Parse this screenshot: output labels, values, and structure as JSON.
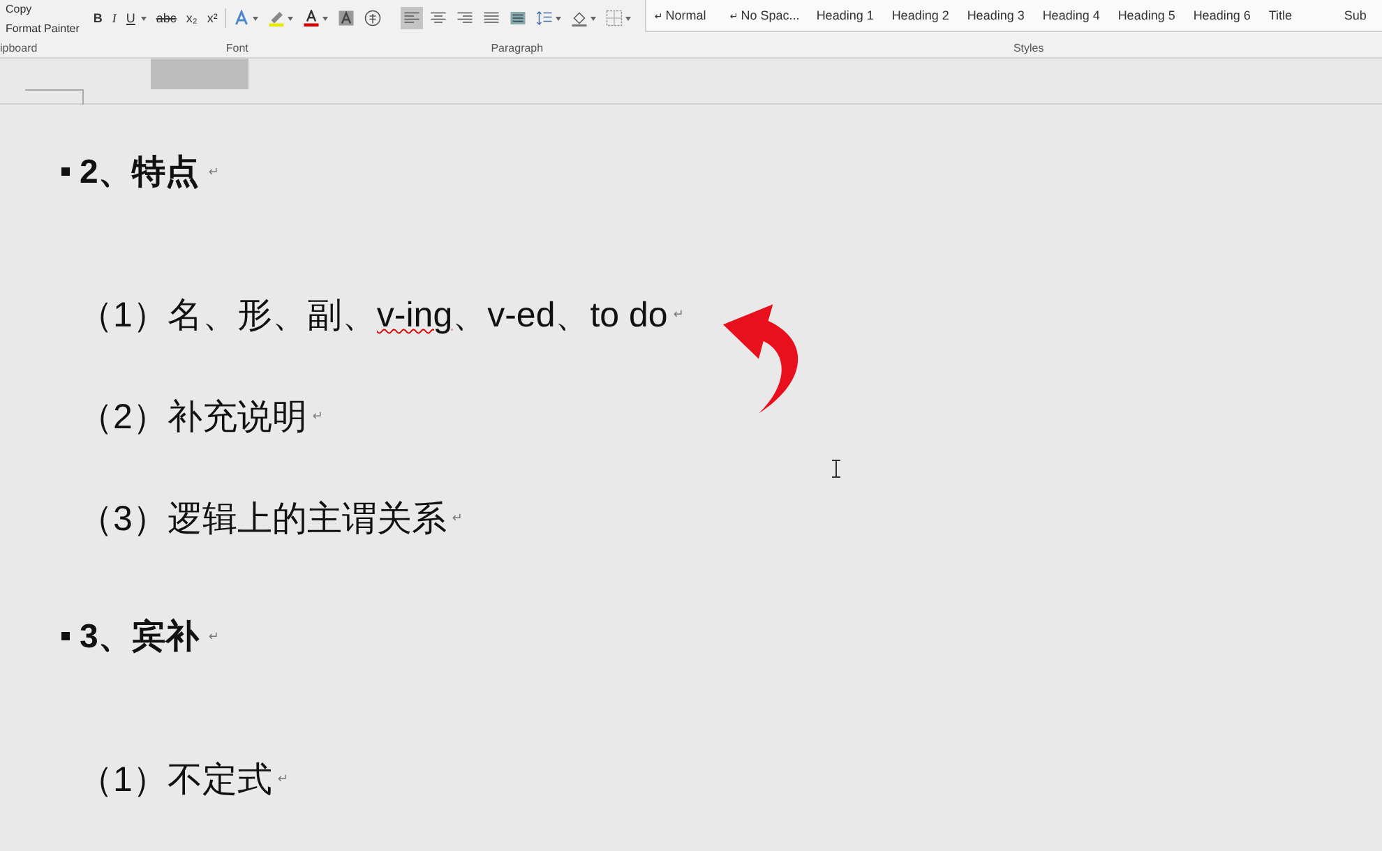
{
  "ribbon": {
    "clipboard": {
      "items": [
        "Copy",
        "Format Painter"
      ],
      "label": "ipboard"
    },
    "font": {
      "buttons": [
        {
          "label": "B",
          "kind": "bold",
          "dropdown": false
        },
        {
          "label": "I",
          "kind": "italic",
          "dropdown": false
        },
        {
          "label": "U",
          "kind": "underline",
          "dropdown": true
        },
        {
          "label": "abc",
          "kind": "strike",
          "dropdown": false
        },
        {
          "label": "x₂",
          "kind": "plain",
          "dropdown": false
        },
        {
          "label": "x²",
          "kind": "plain",
          "dropdown": false
        }
      ],
      "tools": [
        {
          "kind": "text-effects",
          "dropdown": true
        },
        {
          "kind": "highlight",
          "dropdown": true
        },
        {
          "kind": "font-color",
          "dropdown": true
        },
        {
          "kind": "shading",
          "dropdown": false
        },
        {
          "kind": "enclose",
          "dropdown": false
        }
      ],
      "label": "Font"
    },
    "paragraph": {
      "tools": [
        {
          "kind": "align-left",
          "selected": true,
          "dropdown": false
        },
        {
          "kind": "align-center",
          "selected": false,
          "dropdown": false
        },
        {
          "kind": "align-right",
          "selected": false,
          "dropdown": false
        },
        {
          "kind": "justify",
          "selected": false,
          "dropdown": false
        },
        {
          "kind": "distribute",
          "selected": false,
          "dropdown": false
        },
        {
          "kind": "line-spacing",
          "selected": false,
          "dropdown": true
        },
        {
          "kind": "fill",
          "selected": false,
          "dropdown": true
        },
        {
          "kind": "borders",
          "selected": false,
          "dropdown": true
        }
      ],
      "label": "Paragraph"
    },
    "styles": {
      "items": [
        {
          "label": "Normal",
          "mark": "↵"
        },
        {
          "label": "No Spac...",
          "mark": "↵"
        },
        {
          "label": "Heading 1"
        },
        {
          "label": "Heading 2"
        },
        {
          "label": "Heading 3"
        },
        {
          "label": "Heading 4"
        },
        {
          "label": "Heading 5"
        },
        {
          "label": "Heading 6"
        },
        {
          "label": "Title"
        },
        {
          "label": "Sub"
        }
      ],
      "label": "Styles"
    }
  },
  "document": {
    "blocks": [
      {
        "kind": "heading",
        "text": "2、特点",
        "mark": "↵"
      },
      {
        "kind": "item",
        "parts": [
          {
            "text": "（1）名、形、副、",
            "misspelled": false
          },
          {
            "text": "v-ing",
            "misspelled": true
          },
          {
            "text": "、v-ed、to do",
            "misspelled": false
          }
        ],
        "mark": "↵"
      },
      {
        "kind": "item",
        "parts": [
          {
            "text": "（2）补充说明",
            "misspelled": false
          }
        ],
        "mark": "↵"
      },
      {
        "kind": "item",
        "parts": [
          {
            "text": "（3）逻辑上的主谓关系",
            "misspelled": false
          }
        ],
        "mark": "↵"
      },
      {
        "kind": "heading",
        "text": "3、宾补",
        "mark": "↵"
      },
      {
        "kind": "item",
        "parts": [
          {
            "text": "（1）不定式",
            "misspelled": false
          }
        ],
        "mark": "↵"
      }
    ]
  }
}
